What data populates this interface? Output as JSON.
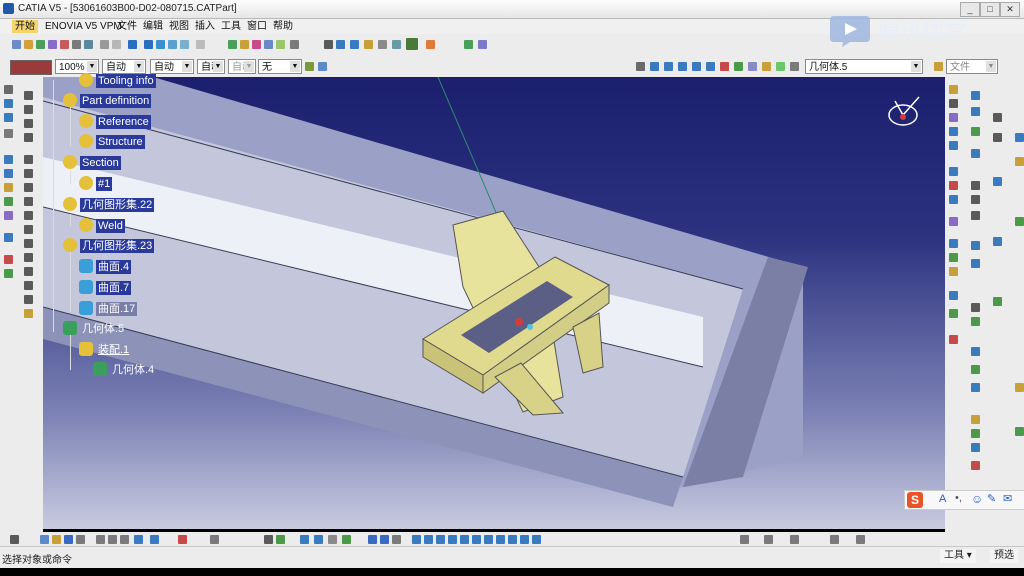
{
  "window": {
    "title": "CATIA V5 - [53061603B00-D02-080715.CATPart]"
  },
  "menu": [
    {
      "label": "开始",
      "active": true
    },
    {
      "label": "ENOVIA V5 VPM",
      "active": false
    },
    {
      "label": "文件",
      "active": false
    },
    {
      "label": "编辑",
      "active": false
    },
    {
      "label": "视图",
      "active": false
    },
    {
      "label": "插入",
      "active": false
    },
    {
      "label": "工具",
      "active": false
    },
    {
      "label": "窗口",
      "active": false
    },
    {
      "label": "帮助",
      "active": false
    }
  ],
  "graphic_props": {
    "color": "#9b3a3a",
    "zoom": "100%",
    "linetype": "自动",
    "thickness": "自动",
    "line_style": "自动",
    "layer_value": "自动",
    "layer": "无"
  },
  "current_body": "几何体.5",
  "file_filter": "文件",
  "tree": [
    {
      "label": "Tooling info",
      "icon": "gear-icon"
    },
    {
      "label": "Part definition",
      "icon": "gear-icon"
    },
    {
      "label": "Reference",
      "icon": "gear-icon"
    },
    {
      "label": "Structure",
      "icon": "gear-icon"
    },
    {
      "label": "Section",
      "icon": "gear-icon"
    },
    {
      "label": "#1",
      "icon": "gear-icon"
    },
    {
      "label": "几何图形集.22",
      "icon": "gear-icon"
    },
    {
      "label": "Weld",
      "icon": "gear-icon"
    },
    {
      "label": "几何图形集.23",
      "icon": "gear-icon"
    },
    {
      "label": "曲面.4",
      "icon": "surface-icon"
    },
    {
      "label": "曲面.7",
      "icon": "surface-icon"
    },
    {
      "label": "曲面.17",
      "icon": "surface-icon"
    },
    {
      "label": "几何体.5",
      "icon": "body-icon"
    },
    {
      "label": "装配.1",
      "icon": "assembly-icon"
    },
    {
      "label": "几何体.4",
      "icon": "body-icon"
    }
  ],
  "watermark": {
    "text": "腾讯课堂"
  },
  "status": {
    "prompt": "选择对象或命令"
  },
  "bottom_buttons": {
    "tools": "工具",
    "preview": "预选"
  },
  "colors": {
    "viewport_top": "#1b1f6e",
    "viewport_bottom": "#c9cbe0",
    "part": "#e7e29c",
    "tree_highlight": "#2a3a9a"
  }
}
